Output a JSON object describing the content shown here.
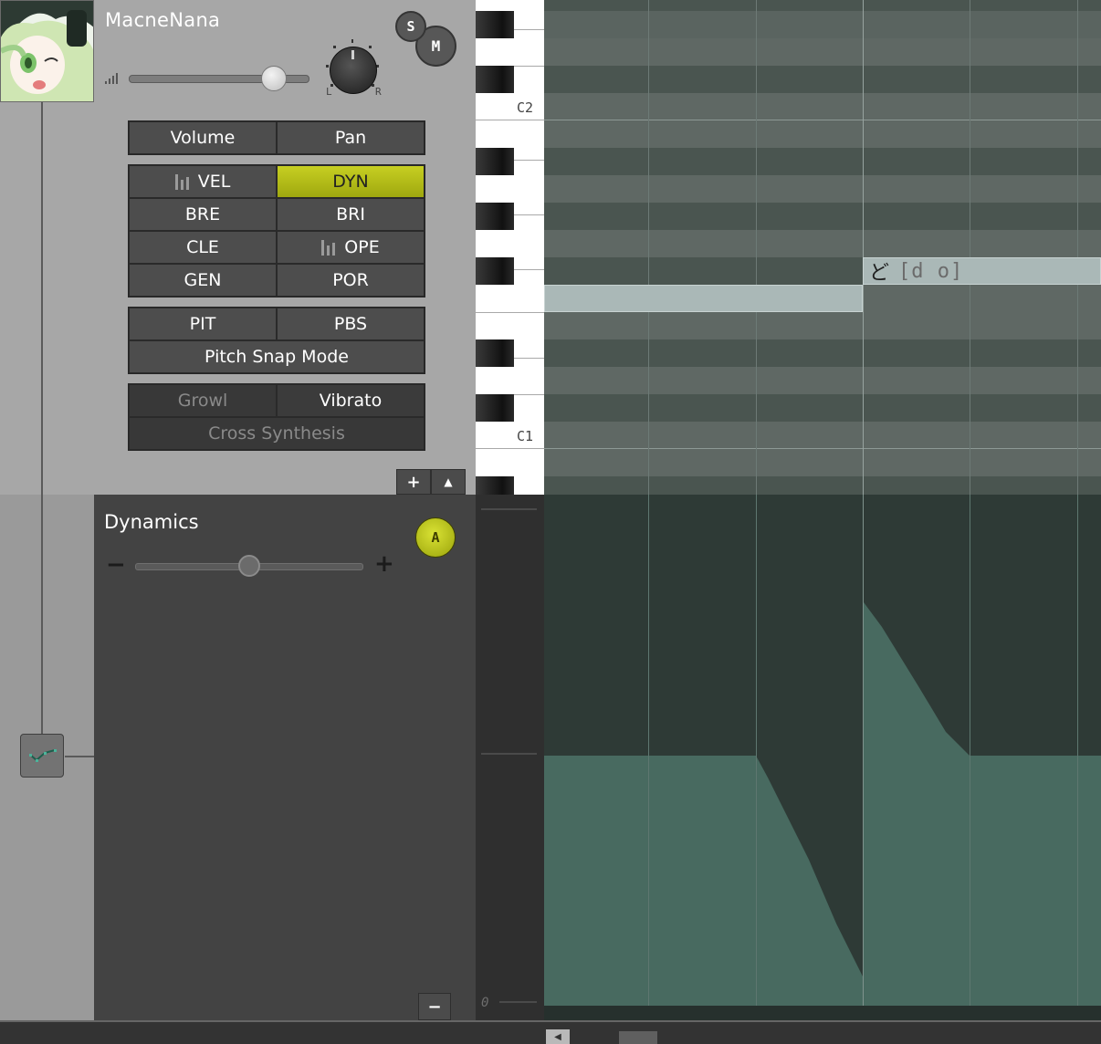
{
  "track": {
    "singer_name": "MacneNana",
    "solo_label": "S",
    "mute_label": "M",
    "pan_left_label": "L",
    "pan_right_label": "R"
  },
  "param_groups": {
    "mix": [
      "Volume",
      "Pan"
    ],
    "params": [
      {
        "label": "VEL",
        "active": false,
        "has_bars": true
      },
      {
        "label": "DYN",
        "active": true,
        "has_bars": false
      },
      {
        "label": "BRE",
        "active": false,
        "has_bars": false
      },
      {
        "label": "BRI",
        "active": false,
        "has_bars": false
      },
      {
        "label": "CLE",
        "active": false,
        "has_bars": false
      },
      {
        "label": "OPE",
        "active": false,
        "has_bars": true
      },
      {
        "label": "GEN",
        "active": false,
        "has_bars": false
      },
      {
        "label": "POR",
        "active": false,
        "has_bars": false
      }
    ],
    "pitch": {
      "pit": "PIT",
      "pbs": "PBS",
      "snap_mode": "Pitch Snap Mode"
    },
    "extras": {
      "growl": "Growl",
      "vibrato": "Vibrato",
      "cross_synthesis": "Cross Synthesis"
    }
  },
  "panel_buttons": {
    "add": "+",
    "collapse_up": "▲",
    "remove": "−"
  },
  "dynamics": {
    "title": "Dynamics",
    "auto_label": "A",
    "minus_label": "−",
    "plus_label": "+",
    "slider_value": 0.5
  },
  "keyboard": {
    "c2_label": "C2",
    "c1_label": "C1",
    "zero_label": "0"
  },
  "notes": [
    {
      "lyric": "",
      "phoneme": ""
    },
    {
      "lyric": "ど",
      "phoneme": "[d o]"
    }
  ],
  "colors": {
    "active_param": "#b6bf1a",
    "note_fill": "#aab8b7",
    "curve_fill": "#486a60",
    "curve_bg": "#2e3a36"
  },
  "icons": {
    "tool": "curve-pencil-icon",
    "volume": "signal-bars-icon"
  }
}
